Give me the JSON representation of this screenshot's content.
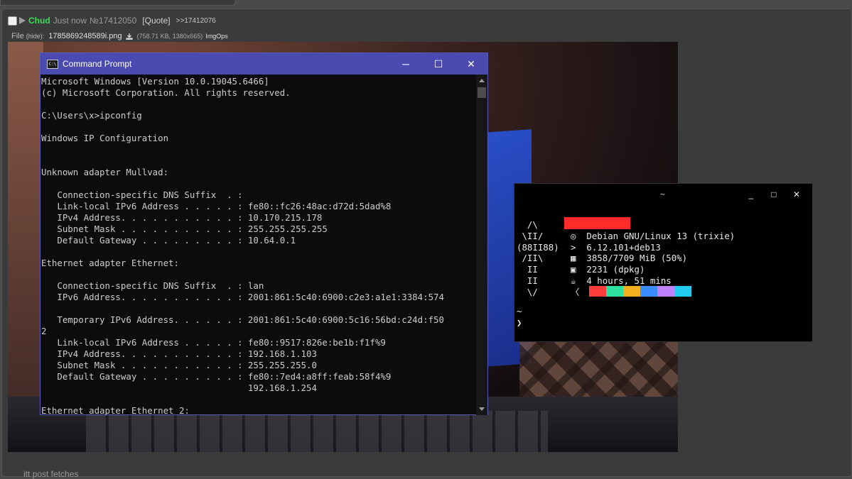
{
  "post": {
    "name": "Chud",
    "time": "Just now",
    "number": "№17412050",
    "quote": "[Quote]",
    "reply_link": ">>17412076",
    "file_label": "File",
    "hide_label": "(hide):",
    "filename": "1785869248589i.png",
    "file_meta": "(758.71 KB, 1380x665)",
    "imgops": "ImgOps",
    "body_text": "itt post fetches"
  },
  "cmd_window": {
    "title": "Command Prompt",
    "minimize": "─",
    "maximize": "☐",
    "close": "✕",
    "lines": [
      "Microsoft Windows [Version 10.0.19045.6466]",
      "(c) Microsoft Corporation. All rights reserved.",
      "",
      "C:\\Users\\x>ipconfig",
      "",
      "Windows IP Configuration",
      "",
      "",
      "Unknown adapter Mullvad:",
      "",
      "   Connection-specific DNS Suffix  . :",
      "   Link-local IPv6 Address . . . . . : fe80::fc26:48ac:d72d:5dad%8",
      "   IPv4 Address. . . . . . . . . . . : 10.170.215.178",
      "   Subnet Mask . . . . . . . . . . . : 255.255.255.255",
      "   Default Gateway . . . . . . . . . : 10.64.0.1",
      "",
      "Ethernet adapter Ethernet:",
      "",
      "   Connection-specific DNS Suffix  . : lan",
      "   IPv6 Address. . . . . . . . . . . : 2001:861:5c40:6900:c2e3:a1e1:3384:574",
      "",
      "   Temporary IPv6 Address. . . . . . : 2001:861:5c40:6900:5c16:56bd:c24d:f50",
      "2",
      "   Link-local IPv6 Address . . . . . : fe80::9517:826e:be1b:f1f%9",
      "   IPv4 Address. . . . . . . . . . . : 192.168.1.103",
      "   Subnet Mask . . . . . . . . . . . : 255.255.255.0",
      "   Default Gateway . . . . . . . . . : fe80::7ed4:a8ff:feab:58f4%9",
      "                                       192.168.1.254",
      "",
      "Ethernet adapter Ethernet 2:"
    ]
  },
  "terminal": {
    "title": "~",
    "minimize": "_",
    "maximize": "□",
    "close": "✕",
    "art": "  /\\\n \\II/\n(88II88)\n /II\\\n  II\n  II\n  \\/",
    "info": "\n@  Debian GNU/Linux 13 (trixie)\n>  6.12.101+deb13\n▦  3858/7709 MiB (50%)\n▣  2231 (dpkg)\n☕  4 hours, 51 mins\n〈",
    "info_lines": [
      "",
      "◎  Debian GNU/Linux 13 (trixie)",
      ">  6.12.101+deb13",
      "▦  3858/7709 MiB (50%)",
      "▣  2231 (dpkg)",
      "☕  4 hours, 51 mins",
      "〈"
    ],
    "prompt": "~\n❯",
    "palette": [
      "#ff3b3b",
      "#2ee0a0",
      "#f0b020",
      "#3a8cff",
      "#c080ff",
      "#22ccee"
    ],
    "redacted_color": "#ff2a2a"
  }
}
